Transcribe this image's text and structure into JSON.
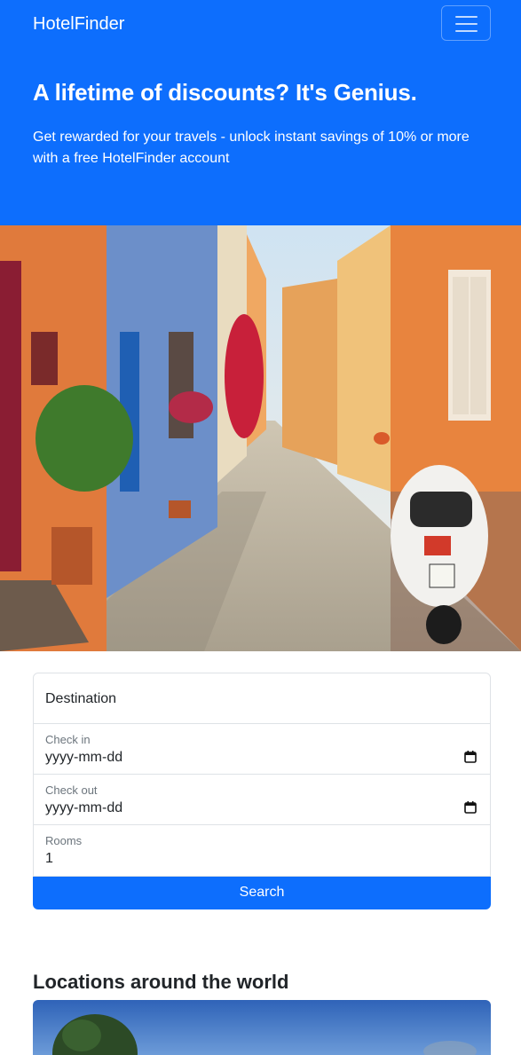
{
  "nav": {
    "brand": "HotelFinder",
    "menu_icon": "hamburger-menu-icon"
  },
  "hero": {
    "title": "A lifetime of discounts? It's Genius.",
    "subtitle": "Get rewarded for your travels - unlock instant savings of 10% or more with a free HotelFinder account"
  },
  "hero_image": {
    "subject": "narrow colorful street with scooter"
  },
  "search": {
    "destination_placeholder": "Destination",
    "checkin_label": "Check in",
    "checkin_value": "yyyy-mm-dd",
    "checkout_label": "Check out",
    "checkout_value": "yyyy-mm-dd",
    "rooms_label": "Rooms",
    "rooms_value": "1",
    "button_label": "Search"
  },
  "locations": {
    "title": "Locations around the world"
  },
  "colors": {
    "primary": "#0d6efd",
    "text": "#212529",
    "muted": "#6c757d",
    "border": "#dee2e6"
  }
}
